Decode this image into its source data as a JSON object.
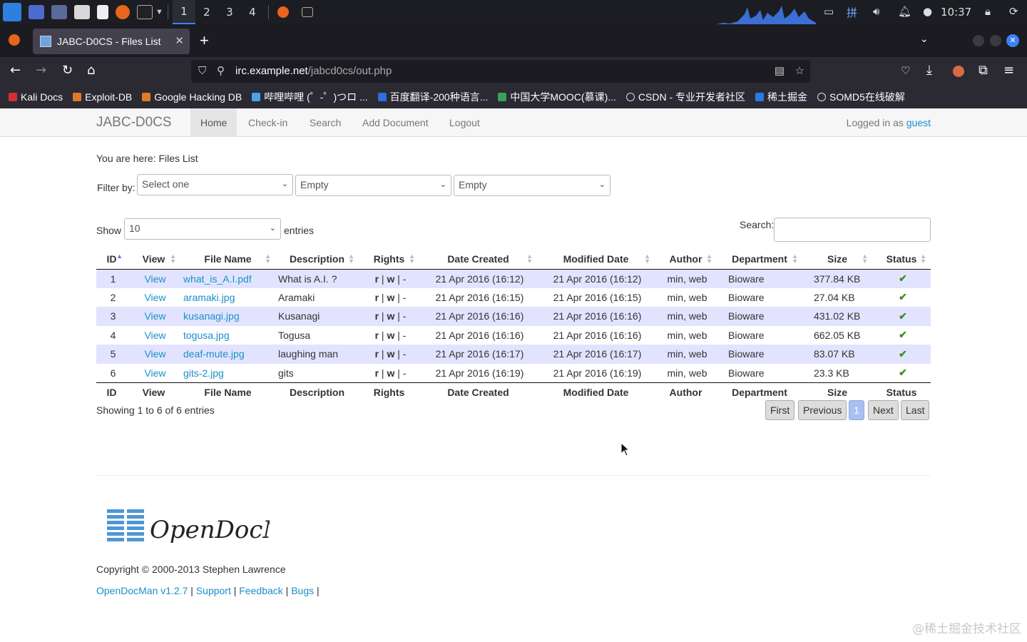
{
  "taskbar": {
    "workspaces": [
      "1",
      "2",
      "3",
      "4"
    ],
    "clock": "10:37",
    "ime": "拼"
  },
  "browser": {
    "tab_title": "JABC-D0CS - Files List",
    "url_host": "irc.example.net",
    "url_path": "/jabcd0cs/out.php",
    "bookmarks": [
      "Kali Docs",
      "Exploit-DB",
      "Google Hacking DB",
      "哔哩哔哩 (゜-゜)つロ ...",
      "百度翻译-200种语言...",
      "中国大学MOOC(慕课)...",
      "CSDN - 专业开发者社区",
      "稀土掘金",
      "SOMD5在线破解"
    ]
  },
  "app": {
    "brand": "JABC-D0CS",
    "nav": [
      "Home",
      "Check-in",
      "Search",
      "Add Document",
      "Logout"
    ],
    "logged_prefix": "Logged in as",
    "user": "guest",
    "breadcrumb": "You are here: Files List",
    "filter_label": "Filter by:",
    "filters": [
      "Select one",
      "Empty",
      "Empty"
    ],
    "show_label": "Show",
    "show_value": "10",
    "entries_label": "entries",
    "search_label": "Search:",
    "columns": [
      "ID",
      "View",
      "File Name",
      "Description",
      "Rights",
      "Date Created",
      "Modified Date",
      "Author",
      "Department",
      "Size",
      "Status"
    ],
    "rows": [
      {
        "id": "1",
        "view": "View",
        "file": "what_is_A.I.pdf",
        "desc": "What is A.I. ?",
        "r": "r",
        "w": "w",
        "x": "-",
        "created": "21 Apr 2016 (16:12)",
        "modified": "21 Apr 2016 (16:12)",
        "author": "min, web",
        "dept": "Bioware",
        "size": "377.84 KB",
        "status": "✔"
      },
      {
        "id": "2",
        "view": "View",
        "file": "aramaki.jpg",
        "desc": "Aramaki",
        "r": "r",
        "w": "w",
        "x": "-",
        "created": "21 Apr 2016 (16:15)",
        "modified": "21 Apr 2016 (16:15)",
        "author": "min, web",
        "dept": "Bioware",
        "size": "27.04 KB",
        "status": "✔"
      },
      {
        "id": "3",
        "view": "View",
        "file": "kusanagi.jpg",
        "desc": "Kusanagi",
        "r": "r",
        "w": "w",
        "x": "-",
        "created": "21 Apr 2016 (16:16)",
        "modified": "21 Apr 2016 (16:16)",
        "author": "min, web",
        "dept": "Bioware",
        "size": "431.02 KB",
        "status": "✔"
      },
      {
        "id": "4",
        "view": "View",
        "file": "togusa.jpg",
        "desc": "Togusa",
        "r": "r",
        "w": "w",
        "x": "-",
        "created": "21 Apr 2016 (16:16)",
        "modified": "21 Apr 2016 (16:16)",
        "author": "min, web",
        "dept": "Bioware",
        "size": "662.05 KB",
        "status": "✔"
      },
      {
        "id": "5",
        "view": "View",
        "file": "deaf-mute.jpg",
        "desc": "laughing man",
        "r": "r",
        "w": "w",
        "x": "-",
        "created": "21 Apr 2016 (16:17)",
        "modified": "21 Apr 2016 (16:17)",
        "author": "min, web",
        "dept": "Bioware",
        "size": "83.07 KB",
        "status": "✔"
      },
      {
        "id": "6",
        "view": "View",
        "file": "gits-2.jpg",
        "desc": "gits",
        "r": "r",
        "w": "w",
        "x": "-",
        "created": "21 Apr 2016 (16:19)",
        "modified": "21 Apr 2016 (16:19)",
        "author": "min, web",
        "dept": "Bioware",
        "size": "23.3 KB",
        "status": "✔"
      }
    ],
    "info": "Showing 1 to 6 of 6 entries",
    "pager": [
      "First",
      "Previous",
      "1",
      "Next",
      "Last"
    ],
    "logo_text": "OpenDocMan",
    "copyright": "Copyright © 2000-2013 Stephen Lawrence",
    "footer_links": [
      "OpenDocMan v1.2.7",
      "Support",
      "Feedback",
      "Bugs"
    ]
  },
  "watermark": "@稀土掘金技术社区",
  "colors": {
    "link": "#1a8fc9",
    "row_stripe": "#e2e4ff",
    "status_ok": "#3c8f1e"
  }
}
